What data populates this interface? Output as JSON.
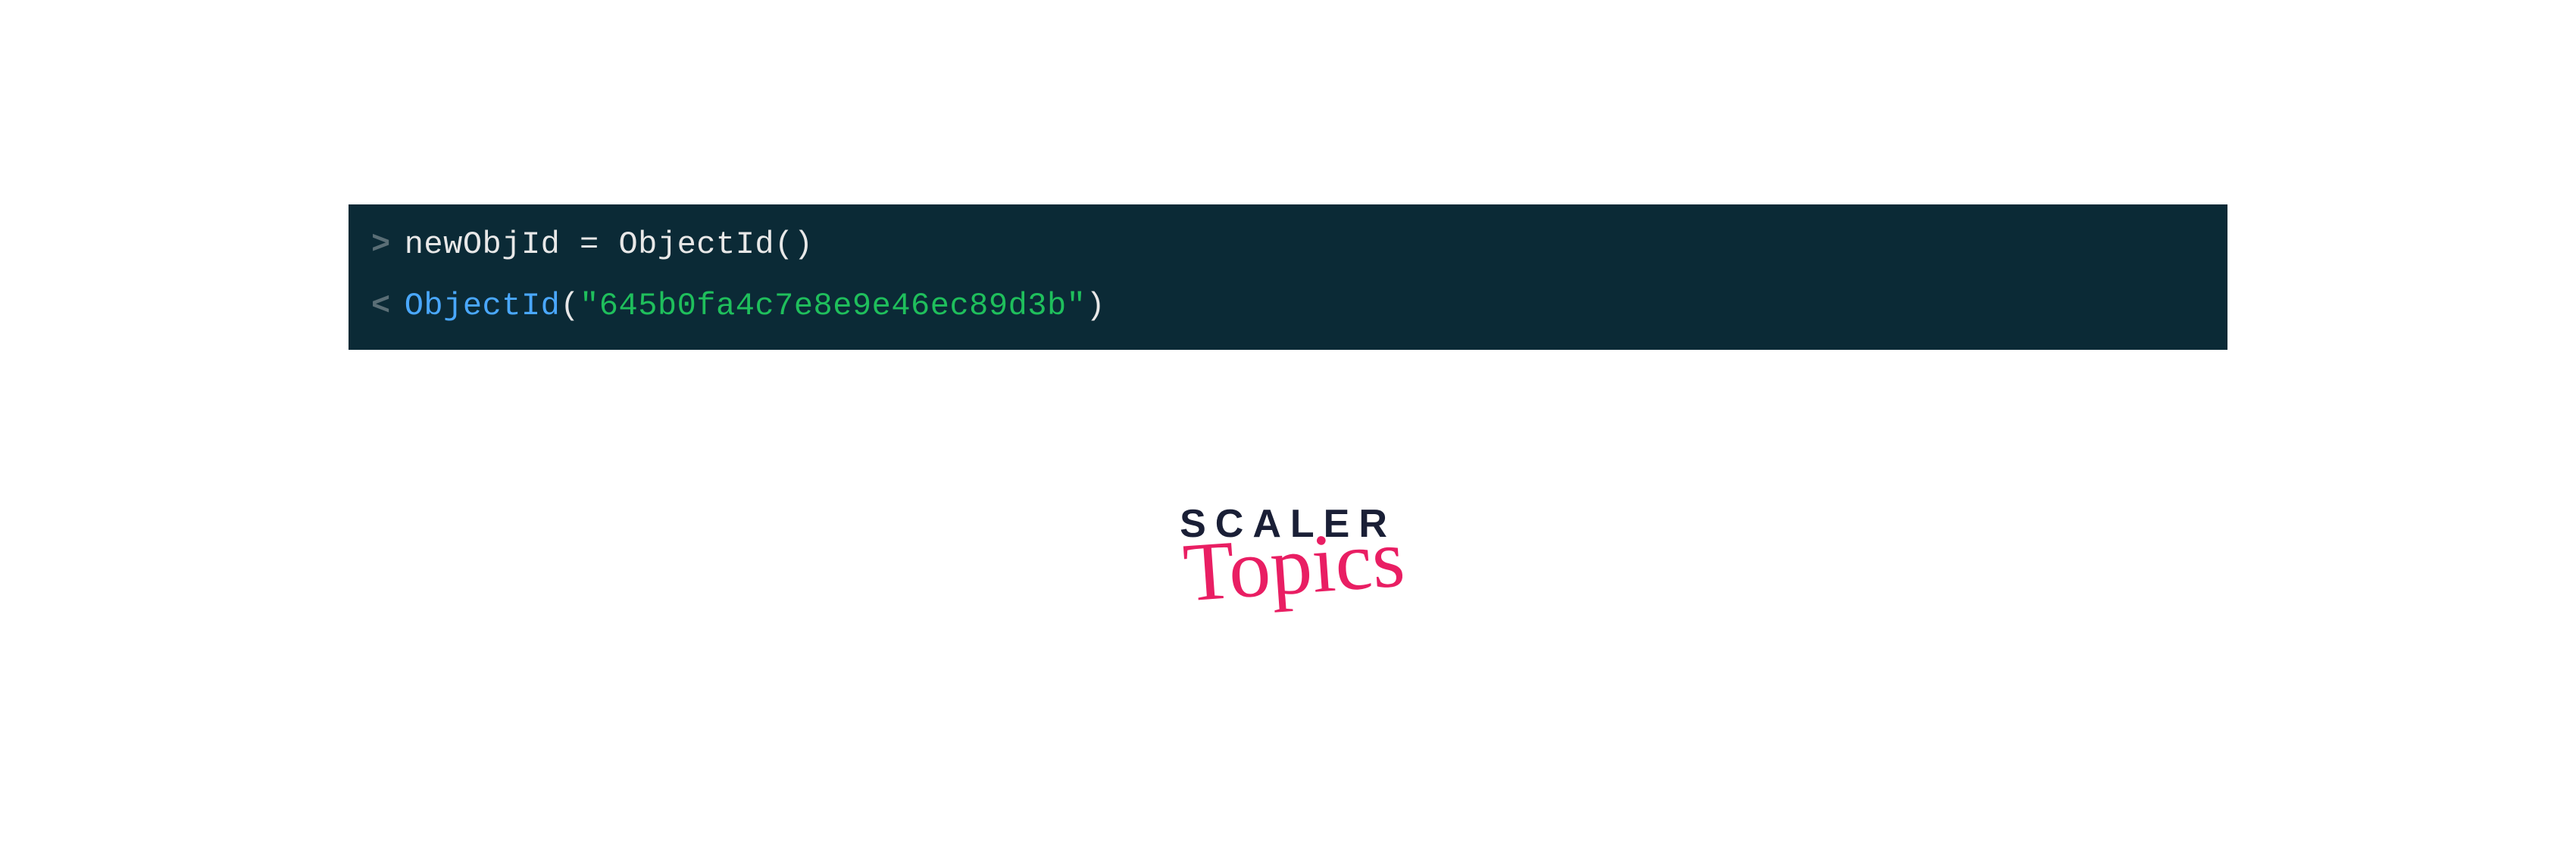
{
  "console": {
    "input": {
      "prompt": ">",
      "command": "newObjId = ObjectId()"
    },
    "output": {
      "prompt": "<",
      "function_name": "ObjectId",
      "paren_open": "(",
      "string_value": "\"645b0fa4c7e8e9e46ec89d3b\"",
      "paren_close": ")"
    }
  },
  "watermark": {
    "line1": "SCALER",
    "line2": "Topics"
  },
  "colors": {
    "console_bg": "#0b2a36",
    "prompt": "#5a6e76",
    "input_text": "#e8e8e8",
    "output_func": "#4aa8ff",
    "output_string": "#1fbf5c",
    "watermark_dark": "#1a1f36",
    "watermark_accent": "#e91e63"
  }
}
